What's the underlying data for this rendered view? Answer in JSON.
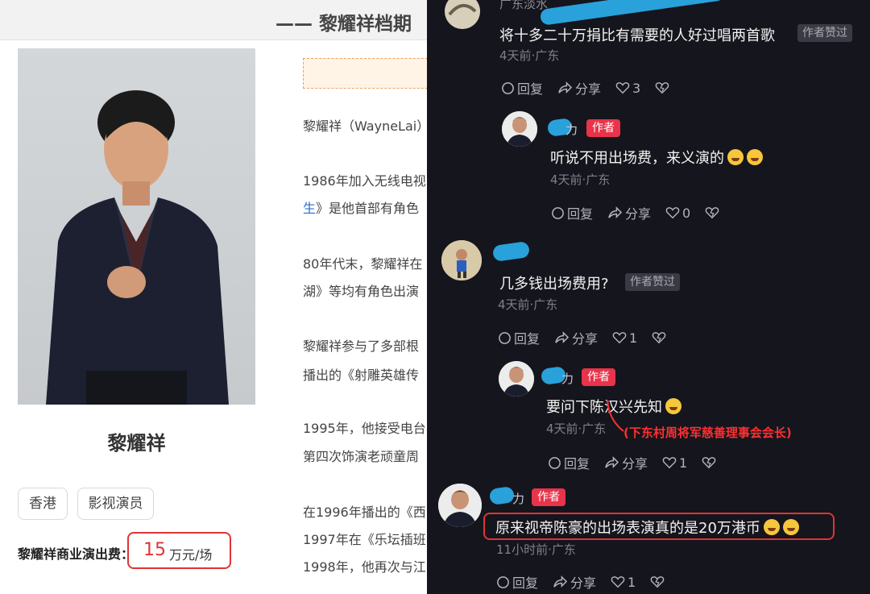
{
  "left": {
    "header_title": "—— 黎耀祥档期",
    "person_name": "黎耀祥",
    "tags": [
      "香港",
      "影视演员"
    ],
    "fee_label": "黎耀祥商业演出费：",
    "fee_value": "15",
    "fee_unit": "万元/场",
    "paragraphs": [
      "黎耀祥（WayneLai）",
      "1986年加入无线电视",
      "生",
      "》是他首部有角色",
      "80年代末，黎耀祥在",
      "湖》等均有角色出演",
      "黎耀祥参与了多部根",
      "播出的《射雕英雄传",
      "1995年，他接受电台",
      "第四次饰演老顽童周",
      "在1996年播出的《西",
      "1997年在《乐坛插班",
      "1998年，他再次与江"
    ]
  },
  "right": {
    "comments": [
      {
        "user": "广东淡水",
        "text": "将十多二十万捐比有需要的人好过唱两首歌",
        "liked_label": "作者赞过",
        "meta": "4天前·广东",
        "reply": "回复",
        "share": "分享",
        "likes": "3"
      },
      {
        "user": "力",
        "badge": "作者",
        "text": "听说不用出场费，来义演的",
        "meta": "4天前·广东",
        "reply": "回复",
        "share": "分享",
        "likes": "0"
      },
      {
        "text": "几多钱出场费用?",
        "liked_label": "作者赞过",
        "meta": "4天前·广东",
        "reply": "回复",
        "share": "分享",
        "likes": "1"
      },
      {
        "user": "力",
        "badge": "作者",
        "text": "要问下陈汉兴先知",
        "meta": "4天前·广东",
        "note": "(下东村周将军慈善理事会会长)",
        "reply": "回复",
        "share": "分享",
        "likes": "1"
      },
      {
        "user": "力",
        "badge": "作者",
        "text": "原来视帝陈豪的出场表演真的是20万港币",
        "meta": "11小时前·广东",
        "reply": "回复",
        "share": "分享",
        "likes": "1"
      }
    ]
  },
  "colors": {
    "dark_bg": "#15151d",
    "author_badge": "#e8334a",
    "highlight_red": "#e03434",
    "link_blue": "#2a6fc9",
    "censor_blue": "#2aa9e6"
  },
  "icons": [
    "reply-icon",
    "share-icon",
    "heart-icon",
    "dislike-icon",
    "laugh-emoji-icon"
  ]
}
